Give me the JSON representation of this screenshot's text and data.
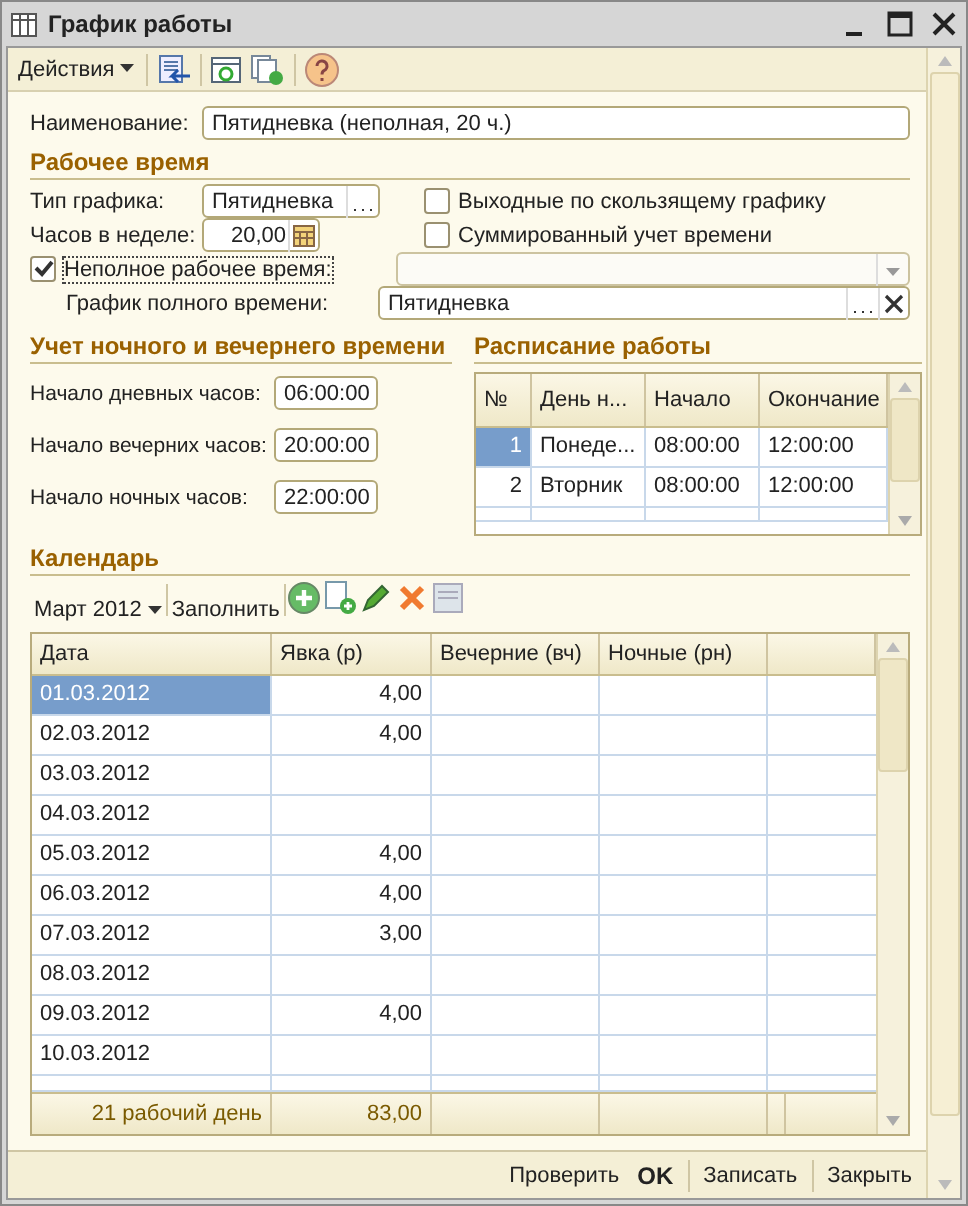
{
  "window": {
    "title": "График работы"
  },
  "toolbar": {
    "actions_menu": "Действия"
  },
  "name_field": {
    "label": "Наименование:",
    "value": "Пятидневка (неполная, 20 ч.)"
  },
  "working_time": {
    "heading": "Рабочее время",
    "schedule_type": {
      "label": "Тип графика:",
      "value": "Пятидневка"
    },
    "hours_per_week": {
      "label": "Часов в неделе:",
      "value": "20,00"
    },
    "checkboxes": [
      {
        "label": "Выходные по скользящему графику",
        "checked": false
      },
      {
        "label": "Суммированный учет времени",
        "checked": false
      }
    ],
    "part_time": {
      "label": "Неполное рабочее время:",
      "checked": true
    },
    "full_time_schedule": {
      "label": "График полного времени:",
      "value": "Пятидневка"
    }
  },
  "night_evening": {
    "heading": "Учет ночного и вечернего времени",
    "fields": [
      {
        "label": "Начало дневных часов:",
        "value": "06:00:00"
      },
      {
        "label": "Начало вечерних часов:",
        "value": "20:00:00"
      },
      {
        "label": "Начало ночных часов:",
        "value": "22:00:00"
      }
    ]
  },
  "work_schedule": {
    "heading": "Расписание работы",
    "columns": [
      "№",
      "День н...",
      "Начало",
      "Окончание"
    ],
    "rows": [
      {
        "cells": [
          "1",
          "Понеде...",
          "08:00:00",
          "12:00:00"
        ],
        "selected": true
      },
      {
        "cells": [
          "2",
          "Вторник",
          "08:00:00",
          "12:00:00"
        ],
        "selected": false
      }
    ]
  },
  "calendar": {
    "heading": "Календарь",
    "month_menu": "Март 2012",
    "fill_button": "Заполнить",
    "columns": [
      "Дата",
      "Явка (р)",
      "Вечерние (вч)",
      "Ночные (рн)"
    ],
    "rows": [
      {
        "cells": [
          "01.03.2012",
          "4,00"
        ],
        "selected": true
      },
      {
        "cells": [
          "02.03.2012",
          "4,00"
        ],
        "selected": false
      },
      {
        "cells": [
          "03.03.2012"
        ],
        "selected": false
      },
      {
        "cells": [
          "04.03.2012"
        ],
        "selected": false
      },
      {
        "cells": [
          "05.03.2012",
          "4,00"
        ],
        "selected": false
      },
      {
        "cells": [
          "06.03.2012",
          "4,00"
        ],
        "selected": false
      },
      {
        "cells": [
          "07.03.2012",
          "3,00"
        ],
        "selected": false
      },
      {
        "cells": [
          "08.03.2012"
        ],
        "selected": false
      },
      {
        "cells": [
          "09.03.2012",
          "4,00"
        ],
        "selected": false
      },
      {
        "cells": [
          "10.03.2012"
        ],
        "selected": false
      }
    ],
    "footer": [
      "21 рабочий день",
      "83,00"
    ]
  },
  "bottom_buttons": [
    {
      "label": "Проверить",
      "kind": "link"
    },
    {
      "label": "OK",
      "kind": "default"
    },
    {
      "label": "Записать",
      "kind": "link"
    },
    {
      "label": "Закрыть",
      "kind": "link"
    }
  ]
}
